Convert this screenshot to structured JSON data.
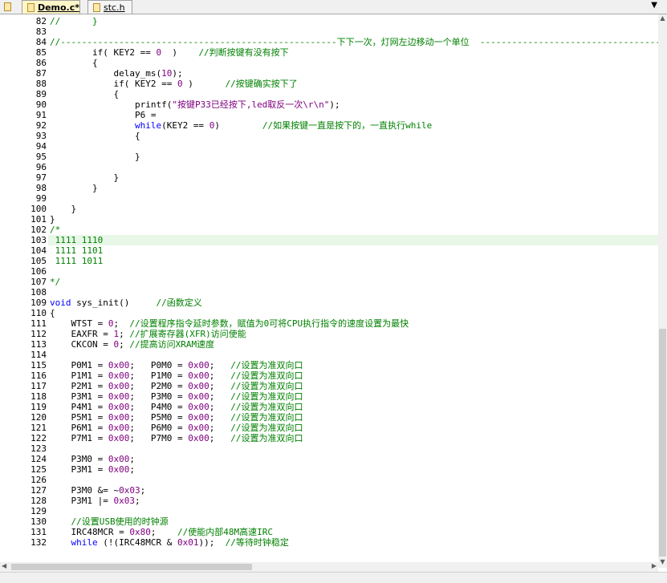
{
  "tabs": [
    {
      "label": "Demo.c*",
      "active": true
    },
    {
      "label": "stc.h",
      "active": false
    }
  ],
  "colors": {
    "number": "#800080",
    "comment": "#008000",
    "keyword": "#0000ff",
    "string": "#800080",
    "highlight": "#e8f7e8"
  },
  "first_line": 82,
  "current_line": 103,
  "lines": [
    [
      {
        "t": "//      }",
        "k": "c"
      }
    ],
    [],
    [
      {
        "t": "//----------------------------------------------------下下一次，灯网左边移动一个单位  ------------------------------------------",
        "k": "c"
      }
    ],
    [
      {
        "t": "        if( KEY2 == "
      },
      {
        "t": "0",
        "k": "n"
      },
      {
        "t": "  )    "
      },
      {
        "t": "//判断按键有没有按下",
        "k": "c"
      }
    ],
    [
      {
        "t": "        {"
      }
    ],
    [
      {
        "t": "            delay_ms("
      },
      {
        "t": "10",
        "k": "n"
      },
      {
        "t": ");"
      }
    ],
    [
      {
        "t": "            if( KEY2 == "
      },
      {
        "t": "0",
        "k": "n"
      },
      {
        "t": " )      "
      },
      {
        "t": "//按键确实按下了",
        "k": "c"
      }
    ],
    [
      {
        "t": "            {"
      }
    ],
    [
      {
        "t": "                printf("
      },
      {
        "t": "\"按键P33已经按下,led取反一次\\r\\n\"",
        "k": "s"
      },
      {
        "t": ");"
      }
    ],
    [
      {
        "t": "                P6 ="
      }
    ],
    [
      {
        "t": "                while",
        "k": "k"
      },
      {
        "t": "(KEY2 == "
      },
      {
        "t": "0",
        "k": "n"
      },
      {
        "t": ")        "
      },
      {
        "t": "//如果按键一直是按下的，一直执行while",
        "k": "c"
      }
    ],
    [
      {
        "t": "                {"
      }
    ],
    [],
    [
      {
        "t": "                }"
      }
    ],
    [],
    [
      {
        "t": "            }"
      }
    ],
    [
      {
        "t": "        }"
      }
    ],
    [],
    [
      {
        "t": "    }"
      }
    ],
    [
      {
        "t": "}"
      }
    ],
    [
      {
        "t": "/*",
        "k": "c"
      }
    ],
    [
      {
        "t": " 1111 1110",
        "k": "c"
      }
    ],
    [
      {
        "t": " 1111 1101",
        "k": "c"
      }
    ],
    [
      {
        "t": " 1111 1011",
        "k": "c"
      }
    ],
    [],
    [
      {
        "t": "*/",
        "k": "c"
      }
    ],
    [],
    [
      {
        "t": "void",
        "k": "k"
      },
      {
        "t": " sys_init()     "
      },
      {
        "t": "//函数定义",
        "k": "c"
      }
    ],
    [
      {
        "t": "{"
      }
    ],
    [
      {
        "t": "    WTST = "
      },
      {
        "t": "0",
        "k": "n"
      },
      {
        "t": ";  "
      },
      {
        "t": "//设置程序指令延时参数，赋值为0可将CPU执行指令的速度设置为最快",
        "k": "c"
      }
    ],
    [
      {
        "t": "    EAXFR = "
      },
      {
        "t": "1",
        "k": "n"
      },
      {
        "t": "; "
      },
      {
        "t": "//扩展寄存器(XFR)访问使能",
        "k": "c"
      }
    ],
    [
      {
        "t": "    CKCON = "
      },
      {
        "t": "0",
        "k": "n"
      },
      {
        "t": "; "
      },
      {
        "t": "//提高访问XRAM速度",
        "k": "c"
      }
    ],
    [],
    [
      {
        "t": "    P0M1 = "
      },
      {
        "t": "0x00",
        "k": "n"
      },
      {
        "t": ";   P0M0 = "
      },
      {
        "t": "0x00",
        "k": "n"
      },
      {
        "t": ";   "
      },
      {
        "t": "//设置为准双向口",
        "k": "c"
      }
    ],
    [
      {
        "t": "    P1M1 = "
      },
      {
        "t": "0x00",
        "k": "n"
      },
      {
        "t": ";   P1M0 = "
      },
      {
        "t": "0x00",
        "k": "n"
      },
      {
        "t": ";   "
      },
      {
        "t": "//设置为准双向口",
        "k": "c"
      }
    ],
    [
      {
        "t": "    P2M1 = "
      },
      {
        "t": "0x00",
        "k": "n"
      },
      {
        "t": ";   P2M0 = "
      },
      {
        "t": "0x00",
        "k": "n"
      },
      {
        "t": ";   "
      },
      {
        "t": "//设置为准双向口",
        "k": "c"
      }
    ],
    [
      {
        "t": "    P3M1 = "
      },
      {
        "t": "0x00",
        "k": "n"
      },
      {
        "t": ";   P3M0 = "
      },
      {
        "t": "0x00",
        "k": "n"
      },
      {
        "t": ";   "
      },
      {
        "t": "//设置为准双向口",
        "k": "c"
      }
    ],
    [
      {
        "t": "    P4M1 = "
      },
      {
        "t": "0x00",
        "k": "n"
      },
      {
        "t": ";   P4M0 = "
      },
      {
        "t": "0x00",
        "k": "n"
      },
      {
        "t": ";   "
      },
      {
        "t": "//设置为准双向口",
        "k": "c"
      }
    ],
    [
      {
        "t": "    P5M1 = "
      },
      {
        "t": "0x00",
        "k": "n"
      },
      {
        "t": ";   P5M0 = "
      },
      {
        "t": "0x00",
        "k": "n"
      },
      {
        "t": ";   "
      },
      {
        "t": "//设置为准双向口",
        "k": "c"
      }
    ],
    [
      {
        "t": "    P6M1 = "
      },
      {
        "t": "0x00",
        "k": "n"
      },
      {
        "t": ";   P6M0 = "
      },
      {
        "t": "0x00",
        "k": "n"
      },
      {
        "t": ";   "
      },
      {
        "t": "//设置为准双向口",
        "k": "c"
      }
    ],
    [
      {
        "t": "    P7M1 = "
      },
      {
        "t": "0x00",
        "k": "n"
      },
      {
        "t": ";   P7M0 = "
      },
      {
        "t": "0x00",
        "k": "n"
      },
      {
        "t": ";   "
      },
      {
        "t": "//设置为准双向口",
        "k": "c"
      }
    ],
    [],
    [
      {
        "t": "    P3M0 = "
      },
      {
        "t": "0x00",
        "k": "n"
      },
      {
        "t": ";"
      }
    ],
    [
      {
        "t": "    P3M1 = "
      },
      {
        "t": "0x00",
        "k": "n"
      },
      {
        "t": ";"
      }
    ],
    [],
    [
      {
        "t": "    P3M0 &= ~"
      },
      {
        "t": "0x03",
        "k": "n"
      },
      {
        "t": ";"
      }
    ],
    [
      {
        "t": "    P3M1 |= "
      },
      {
        "t": "0x03",
        "k": "n"
      },
      {
        "t": ";"
      }
    ],
    [],
    [
      {
        "t": "    //设置USB使用的时钟源",
        "k": "c"
      }
    ],
    [
      {
        "t": "    IRC48MCR = "
      },
      {
        "t": "0x80",
        "k": "n"
      },
      {
        "t": ";    "
      },
      {
        "t": "//使能内部48M高速IRC",
        "k": "c"
      }
    ],
    [
      {
        "t": "    while",
        "k": "k"
      },
      {
        "t": " (!(IRC48MCR & "
      },
      {
        "t": "0x01",
        "k": "n"
      },
      {
        "t": "));  "
      },
      {
        "t": "//等待时钟稳定",
        "k": "c"
      }
    ]
  ]
}
